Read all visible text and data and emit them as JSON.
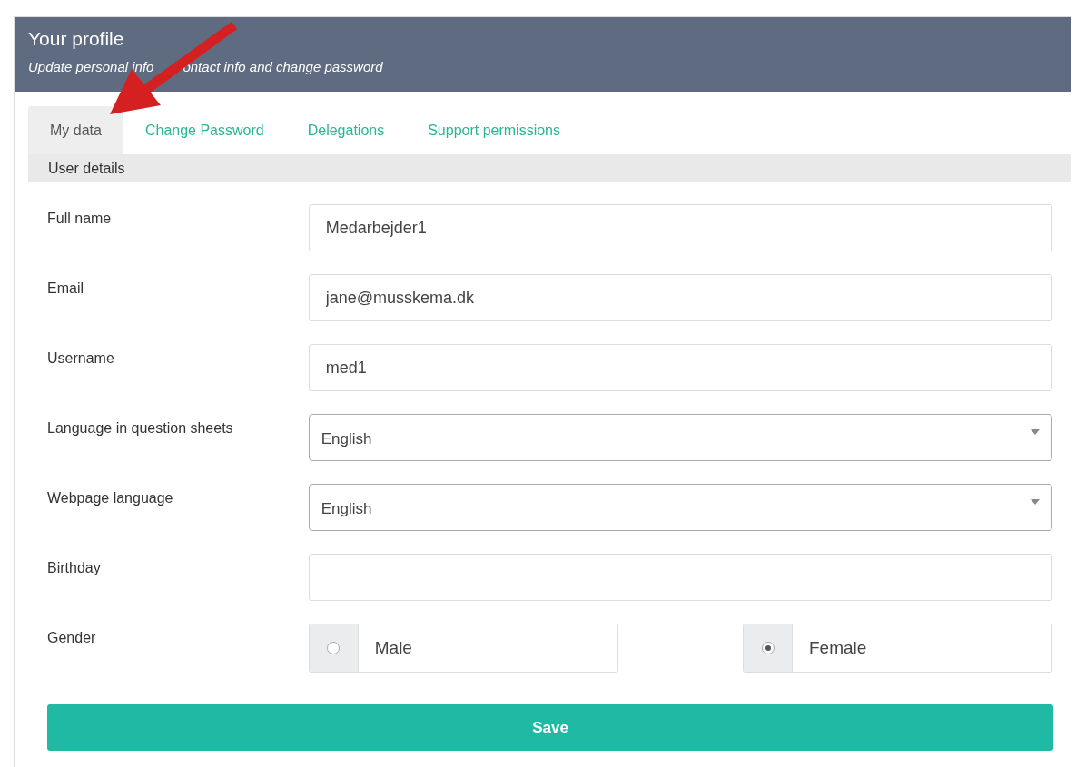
{
  "header": {
    "title": "Your profile",
    "subtitle_parts": [
      "Update personal info",
      "ontact info and change password"
    ]
  },
  "tabs": [
    {
      "label": "My data",
      "selected": true
    },
    {
      "label": "Change Password",
      "selected": false
    },
    {
      "label": "Delegations",
      "selected": false
    },
    {
      "label": "Support permissions",
      "selected": false
    }
  ],
  "section": {
    "title": "User details"
  },
  "fields": [
    {
      "kind": "text",
      "label": "Full name",
      "value": "Medarbejder1"
    },
    {
      "kind": "text",
      "label": "Email",
      "value": "jane@musskema.dk"
    },
    {
      "kind": "text",
      "label": "Username",
      "value": "med1"
    },
    {
      "kind": "select",
      "label": "Language in question sheets",
      "value": "English"
    },
    {
      "kind": "select",
      "label": "Webpage language",
      "value": "English"
    },
    {
      "kind": "text",
      "label": "Birthday"
    },
    {
      "kind": "radio",
      "label": "Gender",
      "options": [
        {
          "label": "Male",
          "selected": false
        },
        {
          "label": "Female",
          "selected": true
        }
      ]
    }
  ],
  "save_button": "Save"
}
